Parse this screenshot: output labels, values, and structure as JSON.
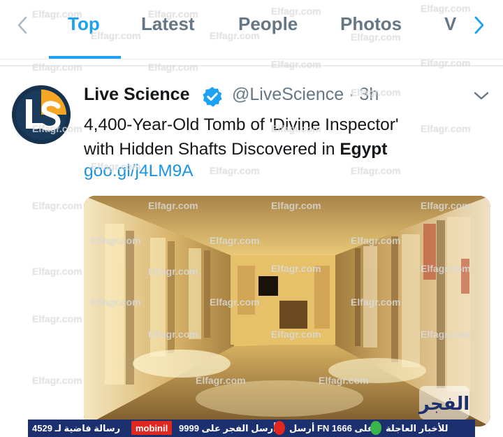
{
  "tabs": {
    "items": [
      {
        "label": "Top",
        "active": true
      },
      {
        "label": "Latest",
        "active": false
      },
      {
        "label": "People",
        "active": false
      },
      {
        "label": "Photos",
        "active": false
      },
      {
        "label": "V",
        "active": false
      }
    ],
    "left_icon": "chevron-left-icon",
    "right_icon": "chevron-right-icon"
  },
  "tweet": {
    "author_name": "Live Science",
    "avatar_icon": "live-science-logo",
    "verified_icon": "verified-badge-icon",
    "handle": "@LiveScience",
    "separator": "·",
    "time": "3h",
    "menu_icon": "chevron-down-icon",
    "text_part1": "4,400-Year-Old Tomb of 'Divine Inspector'",
    "text_part2": "with Hidden Shafts Discovered in ",
    "text_bold": "Egypt",
    "link": "goo.gl/j4LM9A",
    "media_alt": "tomb-interior-photo"
  },
  "watermark": "Elfagr.com",
  "ticker": {
    "item1": "للأخبار العاجلة",
    "item2": "أرسل FN على 1666",
    "item3": "أرسل الفجر على 9999",
    "item4": "mobinil",
    "item5": "رسالة فاضية لـ 4529",
    "logo_text": "الفجر"
  },
  "colors": {
    "accent": "#1da1f2",
    "link": "#1b95e0",
    "muted": "#657786",
    "ticker_bg": "#1c2f6e"
  }
}
